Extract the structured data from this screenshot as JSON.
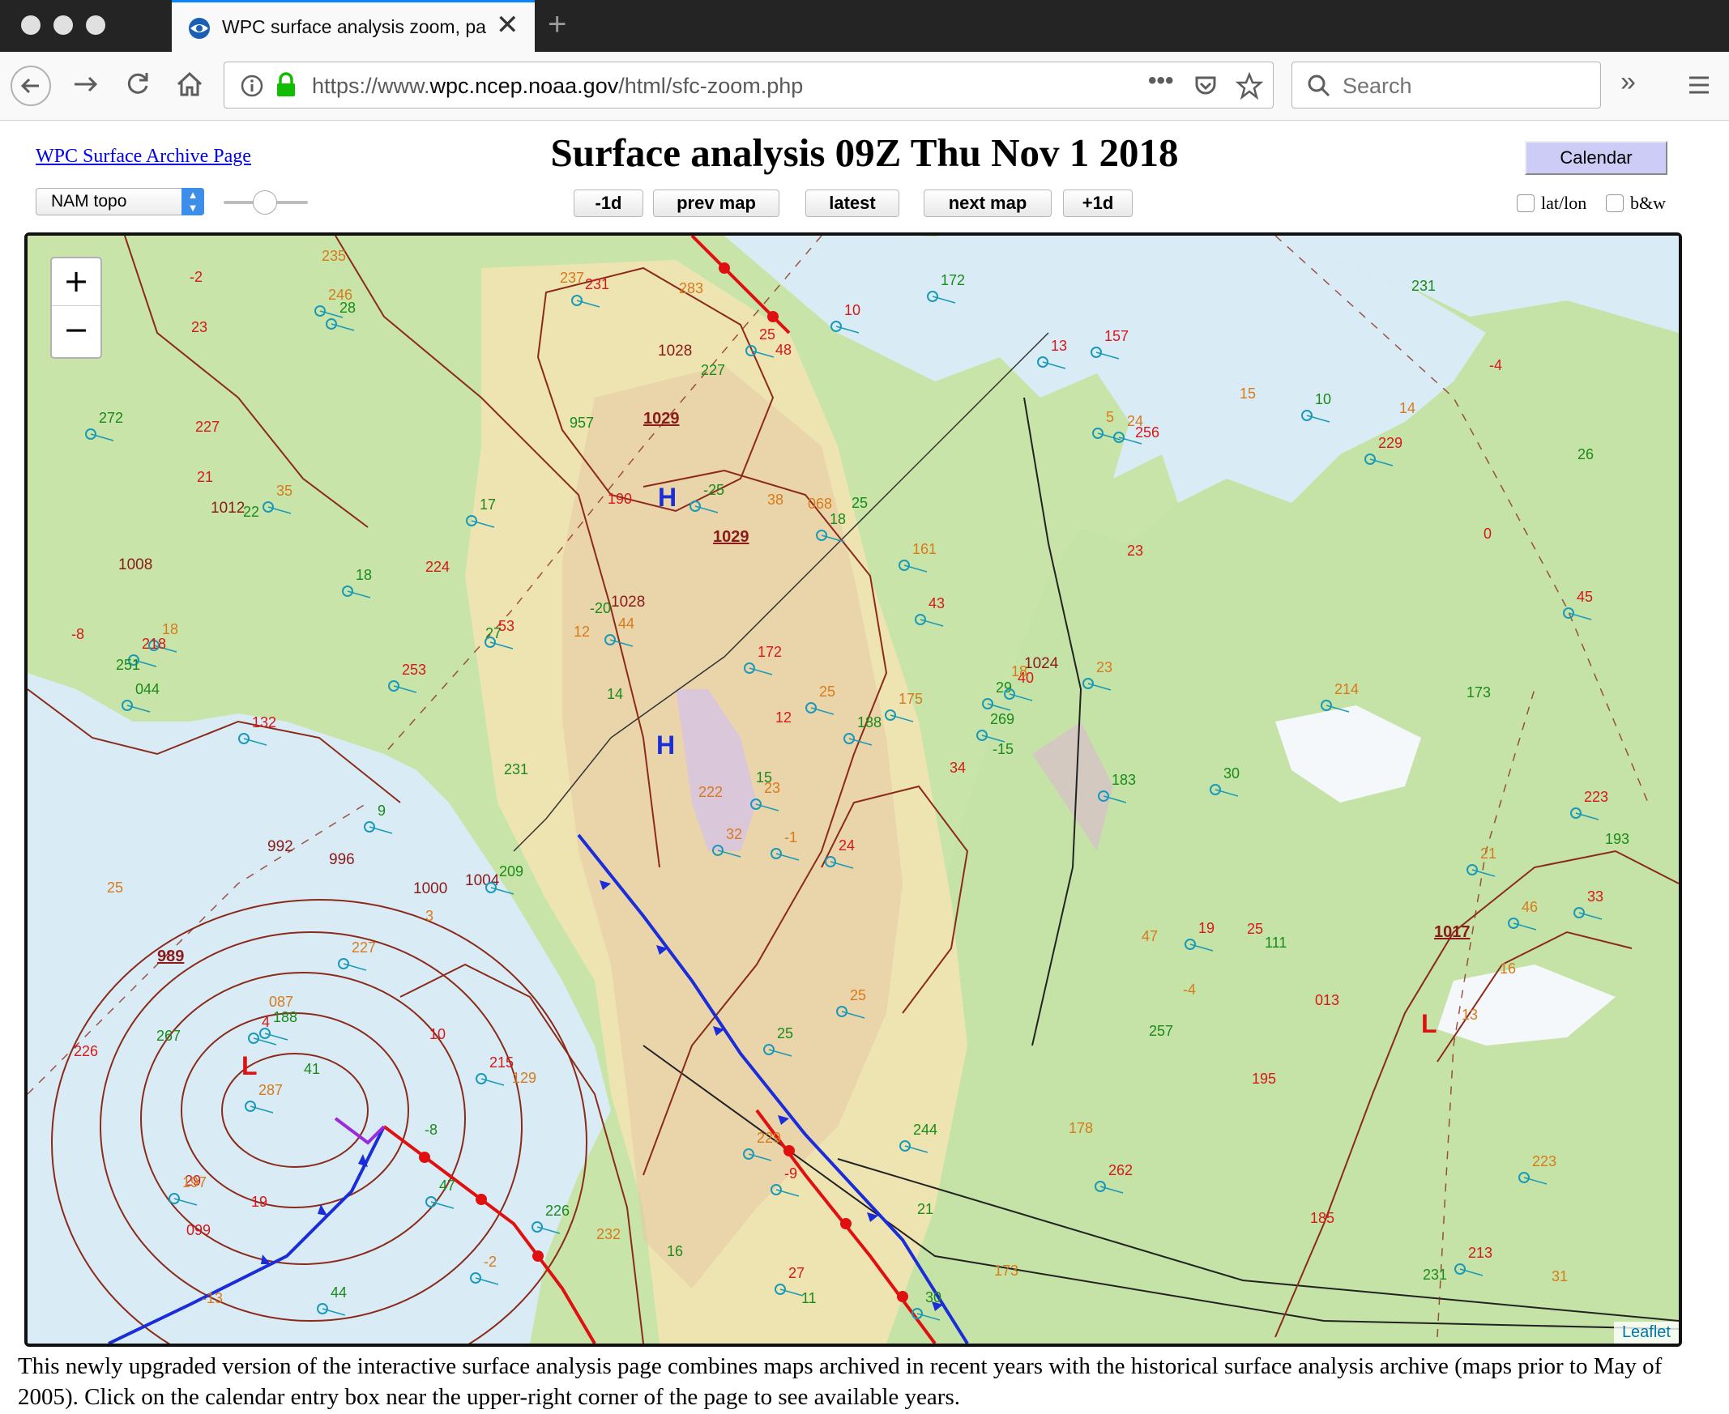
{
  "browser": {
    "tab_title": "WPC surface analysis zoom, pa",
    "url_prefix": "https://www.",
    "url_domain": "wpc.ncep.noaa.gov",
    "url_path": "/html/sfc-zoom.php",
    "search_placeholder": "Search",
    "new_tab": "+",
    "close": "✕"
  },
  "header": {
    "archive_link": "WPC Surface Archive Page",
    "title": "Surface analysis 09Z Thu Nov 1 2018",
    "calendar_label": "Calendar"
  },
  "controls": {
    "map_type": "NAM topo",
    "buttons": [
      "-1d",
      "prev map",
      "latest",
      "next map",
      "+1d"
    ],
    "latlon_label": "lat/lon",
    "bw_label": "b&w"
  },
  "map": {
    "zoom_in": "+",
    "zoom_out": "−",
    "attribution": "Leaflet",
    "pressure_labels": [
      "1029",
      "1029",
      "989",
      "1017",
      "1012",
      "1008",
      "1028",
      "1028",
      "992",
      "996",
      "1000",
      "1004",
      "1024"
    ],
    "high_symbol": "H",
    "low_symbol": "L",
    "station_numbers": [
      "24",
      "22",
      "23",
      "29",
      "29",
      "129",
      "157",
      "25",
      "24",
      "34",
      "28",
      "31",
      "132",
      "26",
      "32",
      "23",
      "44",
      "38",
      "43",
      "41",
      "44",
      "099",
      "47",
      "068",
      "40",
      "111",
      "35",
      "48",
      "044",
      "47",
      "45",
      "15",
      "229",
      "12",
      "17",
      "15",
      "215",
      "231",
      "223",
      "25",
      "172",
      "12",
      "253",
      "257",
      "-2",
      "-8",
      "269",
      "-13",
      "-9",
      "-15",
      "287",
      "0",
      "272",
      "-4",
      "262",
      "-8",
      "246",
      "-2",
      "244",
      "14",
      "10",
      "231",
      "18",
      "224",
      "10",
      "235",
      "13",
      "227",
      "25",
      "226",
      "25",
      "232",
      "19",
      "27",
      "197",
      "23",
      "18",
      "25",
      "172",
      "21",
      "175",
      "19",
      "183",
      "16",
      "27",
      "173",
      "25",
      "185",
      "30",
      "178",
      "25",
      "193",
      "23",
      "195",
      "188",
      "13",
      "218",
      "11",
      "5",
      "256",
      "9",
      "237",
      "223",
      "251",
      "227",
      "10",
      "226",
      "18",
      "229",
      "14",
      "21",
      "227",
      "18",
      "222",
      "231",
      "267",
      "-1",
      "-4",
      "-25",
      "283",
      "4",
      "231",
      "161",
      "190",
      "30",
      "3",
      "213",
      "16",
      "214",
      "21",
      "188",
      "173",
      "53",
      "957",
      "46",
      "013",
      "209",
      "087",
      "33",
      "-20"
    ]
  },
  "footer": {
    "text": "This newly upgraded version of the interactive surface analysis page combines maps archived in recent years with the historical surface analysis archive (maps prior to May of 2005). Click on the calendar entry box near the upper-right corner of the page to see available years."
  }
}
